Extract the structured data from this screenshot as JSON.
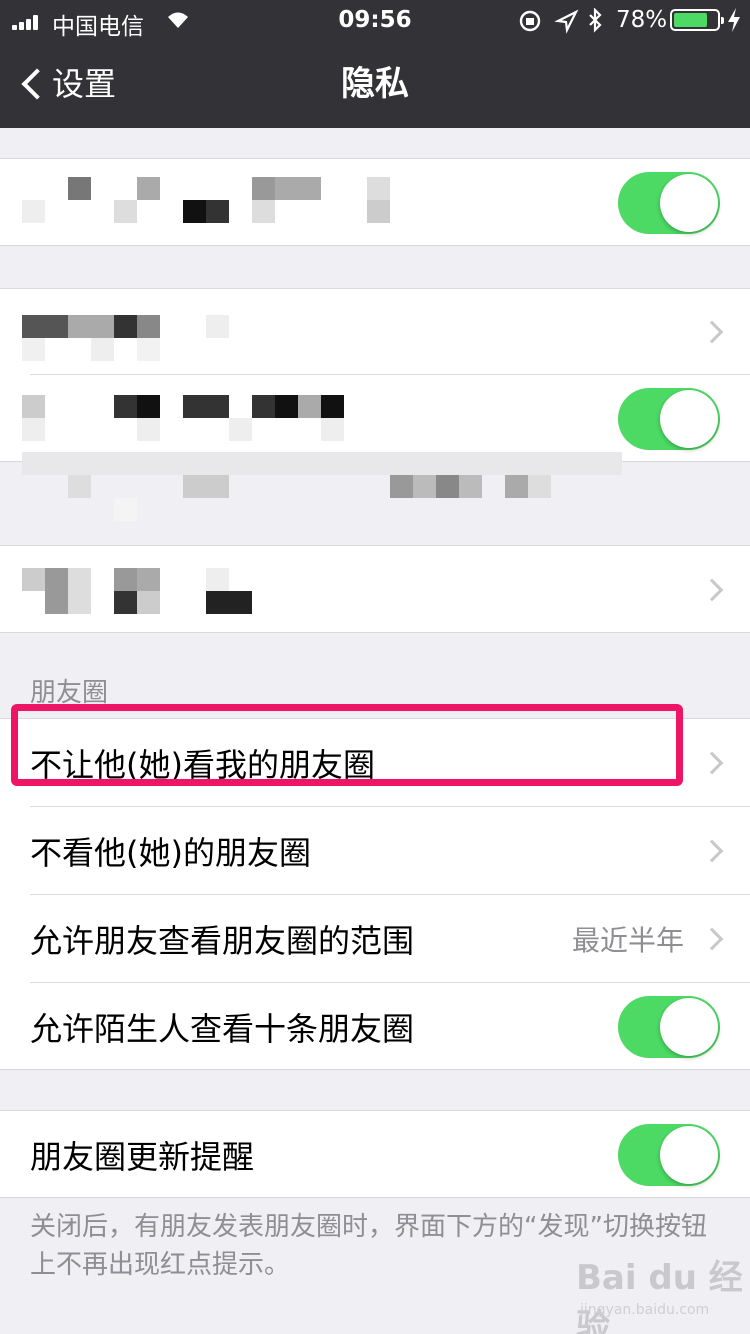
{
  "status_bar": {
    "carrier": "中国电信",
    "time": "09:56",
    "battery_percent": "78%",
    "battery_level": 0.78,
    "icons": [
      "signal-icon",
      "wifi-icon",
      "rotation-lock-icon",
      "location-icon",
      "bluetooth-icon",
      "battery-icon",
      "charging-icon"
    ]
  },
  "nav": {
    "back_label": "设置",
    "title": "隐私"
  },
  "blurred_rows": [
    {
      "control": "toggle",
      "on": true
    },
    {
      "control": "chevron"
    },
    {
      "control": "toggle",
      "on": true
    },
    {
      "control": "chevron"
    }
  ],
  "moments": {
    "section_header": "朋友圈",
    "items": [
      {
        "label": "不让他(她)看我的朋友圈",
        "control": "chevron",
        "highlighted": true
      },
      {
        "label": "不看他(她)的朋友圈",
        "control": "chevron"
      },
      {
        "label": "允许朋友查看朋友圈的范围",
        "value": "最近半年",
        "control": "chevron"
      },
      {
        "label": "允许陌生人查看十条朋友圈",
        "control": "toggle",
        "on": true
      }
    ]
  },
  "update_reminder": {
    "label": "朋友圈更新提醒",
    "control": "toggle",
    "on": true,
    "footnote": "关闭后，有朋友发表朋友圈时，界面下方的“发现”切换按钮上不再出现红点提示。"
  },
  "watermark": {
    "text": "Bai du 经验",
    "url": "jingyan.baidu.com"
  },
  "colors": {
    "nav_background": "#333337",
    "toggle_on": "#4cd964",
    "highlight_border": "#ef1566",
    "page_background": "#efeff4"
  }
}
